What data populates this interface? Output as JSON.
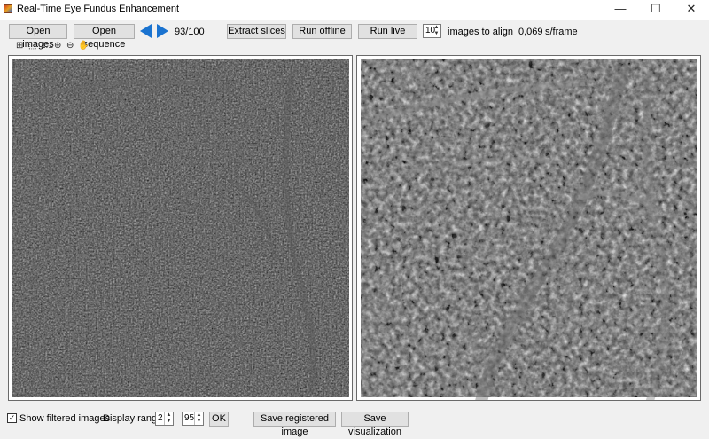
{
  "window": {
    "title": "Real-Time Eye Fundus Enhancement",
    "minimize_glyph": "—",
    "maximize_glyph": "☐",
    "close_glyph": "✕"
  },
  "toolbar": {
    "open_images": "Open images",
    "open_sequence": "Open sequence",
    "frame_counter": "93/100",
    "extract_slices": "Extract slices",
    "run_offline": "Run offline",
    "run_live": "Run live",
    "align_count": "10",
    "align_label": "images to align",
    "speed_value": "0,069",
    "speed_unit": "s/frame"
  },
  "viewer_tools": {
    "fit_icon": "⊞",
    "select_icon": "⬚",
    "one_to_one": "1:1",
    "zoom_in_icon": "⊕",
    "zoom_out_icon": "⊖",
    "pan_icon": "✋"
  },
  "bottom": {
    "show_filtered_checked": "✓",
    "show_filtered_label": "Show filtered images",
    "display_range_label": "Display range:",
    "range_min": "2",
    "range_max": "95",
    "ok": "OK",
    "save_registered": "Save registered image",
    "save_visualization": "Save visualization"
  },
  "colors": {
    "accent_arrow": "#1a73d0",
    "button_face": "#e1e1e1",
    "window_bg": "#f0f0f0"
  }
}
